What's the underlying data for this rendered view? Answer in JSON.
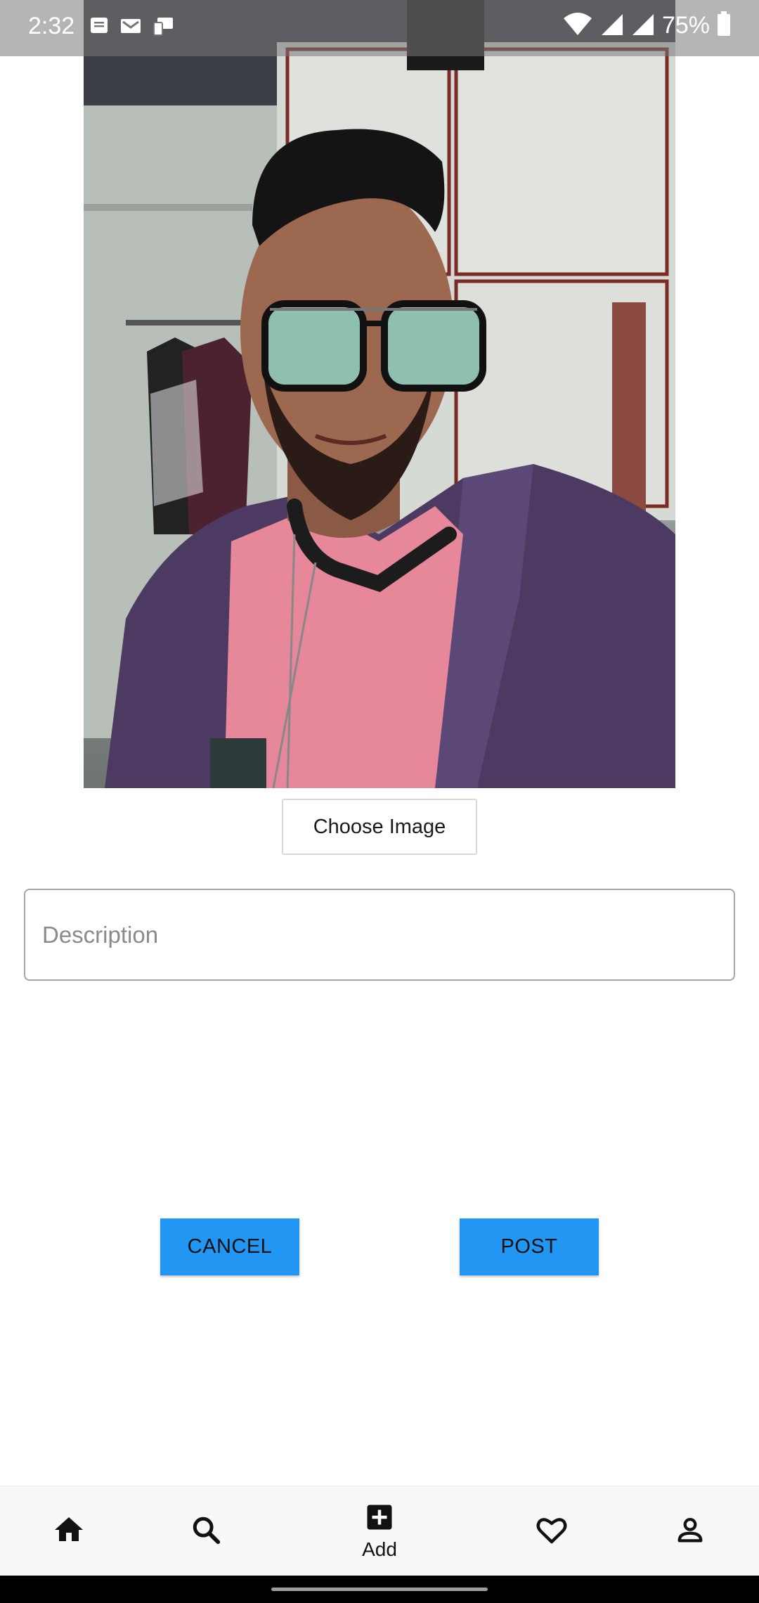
{
  "status_bar": {
    "time": "2:32",
    "battery": "75%",
    "left_icons": [
      "message-icon",
      "gmail-icon",
      "device-icon"
    ],
    "right_icons": [
      "wifi-icon",
      "signal-icon",
      "signal-icon",
      "battery-icon"
    ]
  },
  "preview": {
    "content": "selfie-photo"
  },
  "form": {
    "choose_image_label": "Choose Image",
    "description_placeholder": "Description",
    "description_value": ""
  },
  "actions": {
    "cancel_label": "CANCEL",
    "post_label": "POST"
  },
  "bottom_nav": {
    "items": [
      {
        "icon": "home-icon",
        "label": ""
      },
      {
        "icon": "search-icon",
        "label": ""
      },
      {
        "icon": "add-box-icon",
        "label": "Add"
      },
      {
        "icon": "heart-icon",
        "label": ""
      },
      {
        "icon": "person-icon",
        "label": ""
      }
    ]
  },
  "colors": {
    "accent": "#2196f3",
    "status_bar": "#787878",
    "nav_background": "#f8f8f8"
  }
}
